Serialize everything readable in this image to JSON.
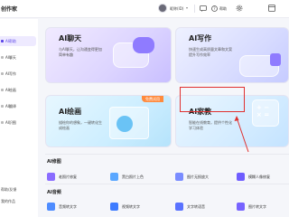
{
  "header": {
    "app_title": "创作家",
    "user_label": "昵称(ID)",
    "user_caret": "▾",
    "help_label": "帮助",
    "icons": [
      "user-avatar",
      "message-icon",
      "help-icon",
      "settings-icon",
      "window-icon"
    ]
  },
  "sidebar": {
    "items": [
      {
        "label": "AI帮助"
      },
      {
        "label": "AI聊天"
      },
      {
        "label": "AI写作"
      },
      {
        "label": "AI绘画"
      },
      {
        "label": "AI翻译"
      },
      {
        "label": "AI识图"
      }
    ],
    "active_index": 0,
    "bottom_items": [
      {
        "label": "帮助/反馈"
      },
      {
        "label": "我的作品"
      }
    ]
  },
  "cards": {
    "chat": {
      "title": "AI聊天",
      "desc_line1": "与AI聊天，让沟通变得更加",
      "desc_line2": "简单有趣"
    },
    "write": {
      "title": "AI写作",
      "desc_line1": "快速生成高质量文章和文案",
      "desc_line2": "提升写作效率"
    },
    "draw": {
      "title": "AI绘画",
      "desc_line1": "描绘你的想象，一键转化生",
      "desc_line2": "成绘画",
      "badge": "免费试用"
    },
    "tutor": {
      "title": "AI家教",
      "desc_line1": "智能在线教育，提供个性化",
      "desc_line2": "学习体验"
    }
  },
  "sections": {
    "ai_image": {
      "title": "AI修图",
      "tools": [
        {
          "label": "老照片修复"
        },
        {
          "label": "黑白照片上色"
        },
        {
          "label": "图片无损放大"
        },
        {
          "label": "模糊人像修复"
        }
      ]
    },
    "ai_audio": {
      "title": "AI音频",
      "tools": [
        {
          "label": "音频转文字"
        },
        {
          "label": "视频转文字"
        },
        {
          "label": "文字转语音"
        },
        {
          "label": "图片转文字"
        }
      ]
    }
  },
  "colors": {
    "accent": "#5b45e8",
    "annotation": "#e0302f",
    "badge": "#ff8a3d"
  }
}
